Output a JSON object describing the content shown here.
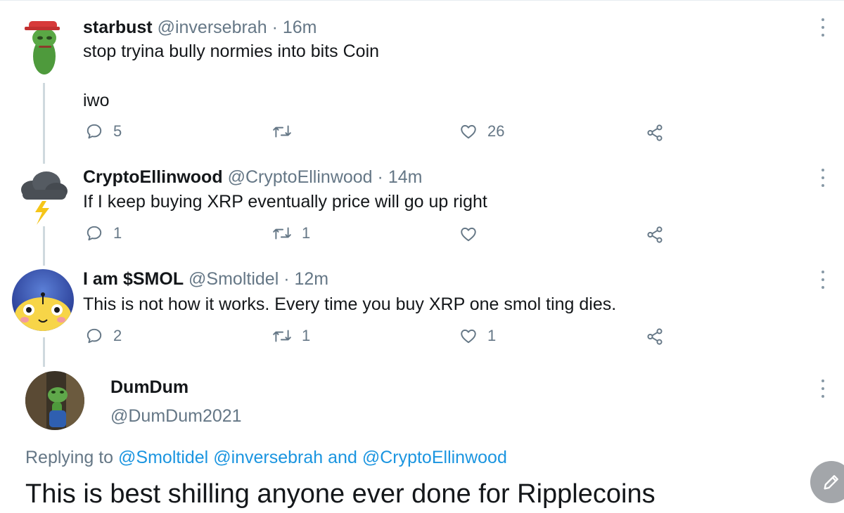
{
  "tweets": [
    {
      "name": "starbust",
      "handle": "@inversebrah",
      "sep": "·",
      "time": "16m",
      "lines": [
        "stop tryina bully normies into bits Coin",
        "iwo"
      ],
      "replies": "5",
      "retweets": "",
      "likes": "26"
    },
    {
      "name": "CryptoEllinwood",
      "handle": "@CryptoEllinwood",
      "sep": "·",
      "time": "14m",
      "lines": [
        "If I keep buying XRP eventually price will go up right"
      ],
      "replies": "1",
      "retweets": "1",
      "likes": ""
    },
    {
      "name": "I am $SMOL",
      "handle": "@Smoltidel",
      "sep": "·",
      "time": "12m",
      "lines": [
        "This is not how it works. Every time you buy XRP one smol ting dies."
      ],
      "replies": "2",
      "retweets": "1",
      "likes": "1"
    }
  ],
  "main_tweet": {
    "name": "DumDum",
    "handle": "@DumDum2021",
    "replying_prefix": "Replying to",
    "mention_1": "@Smoltidel",
    "mention_2": "@inversebrah",
    "conjunction": "and",
    "mention_3": "@CryptoEllinwood",
    "text": "This is best shilling anyone ever done for Ripplecoins"
  },
  "icons": {
    "reply": "reply-icon",
    "retweet": "retweet-icon",
    "like": "heart-icon",
    "share": "share-icon",
    "more": "more-vertical-icon",
    "compose": "compose-pencil-icon"
  },
  "colors": {
    "text": "#14171a",
    "secondary": "#657786",
    "link": "#1b95e0",
    "thread_line": "#cfd9de",
    "fab": "#a3a6aa"
  }
}
